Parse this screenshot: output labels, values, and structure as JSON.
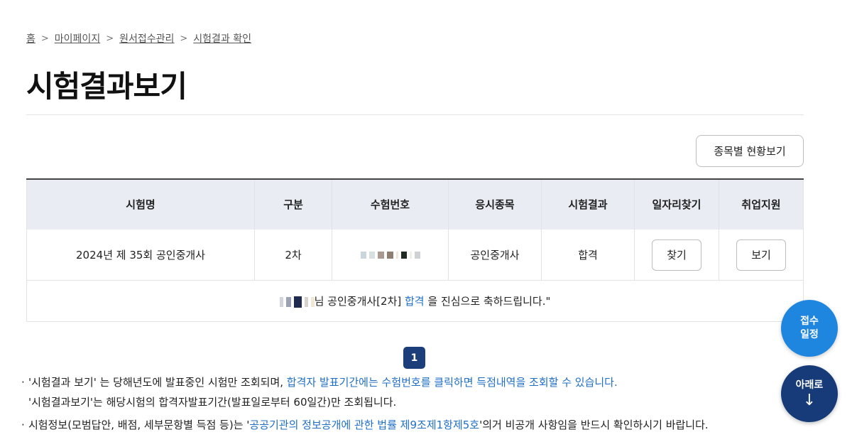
{
  "breadcrumb": {
    "home": "홈",
    "mypage": "마이페이지",
    "application": "원서접수관리",
    "current": "시험결과 확인"
  },
  "page_title": "시험결과보기",
  "status_button": "종목별 현황보기",
  "table": {
    "headers": [
      "시험명",
      "구분",
      "수험번호",
      "응시종목",
      "시험결과",
      "일자리찾기",
      "취업지원"
    ],
    "row": {
      "exam_name": "2024년 제 35회 공인중개사",
      "round": "2차",
      "subject": "공인중개사",
      "result": "합격",
      "job_button": "찾기",
      "support_button": "보기"
    },
    "message": {
      "before": "님 공인중개사[2차] ",
      "highlight": "합격",
      "after": " 을 진심으로 축하드립니다.\""
    }
  },
  "pagination": {
    "current": "1"
  },
  "notes": {
    "line1_a": "'시험결과 보기' 는 당해년도에 발표중인 시험만 조회되며, ",
    "line1_b": "합격자 발표기간에는 수험번호를 클릭하면 득점내역을 조회할 수 있습니다.",
    "line2": "'시험결과보기'는 해당시험의 합격자발표기간(발표일로부터 60일간)만 조회됩니다.",
    "line3_a": "시험정보(모범답안, 배점, 세부문항별 득점 등)는 '",
    "line3_b": "공공기관의 정보공개에 관한 법률 제9조제1항제5호",
    "line3_c": "'의거 비공개 사항임을 반드시 확인하시기 바랍니다."
  },
  "fab": {
    "schedule_line1": "접수",
    "schedule_line2": "일정",
    "down_label": "아래로",
    "down_arrow": "↓"
  },
  "colors": {
    "accent_blue": "#1f6fc7",
    "navy": "#1c3f7c",
    "fab_blue": "#1f86e0",
    "header_bg": "#e9ecf2"
  }
}
